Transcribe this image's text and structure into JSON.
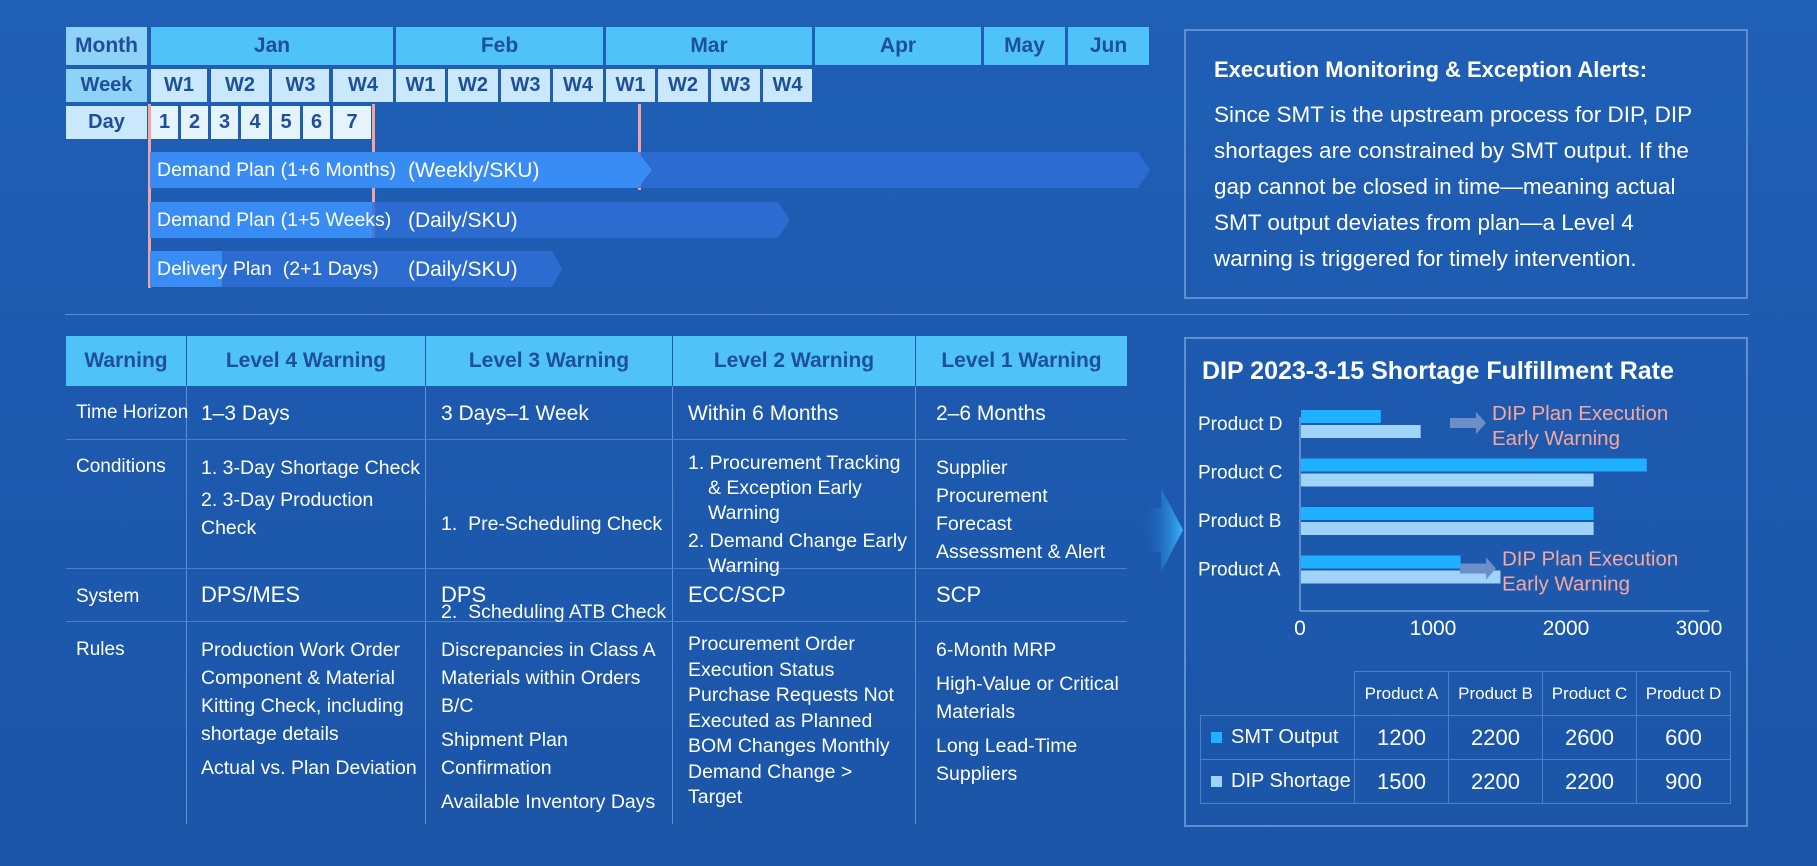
{
  "timeline": {
    "row_labels": {
      "month": "Month",
      "week": "Week",
      "day": "Day"
    },
    "months": [
      "Jan",
      "Feb",
      "Mar",
      "Apr",
      "May",
      "Jun"
    ],
    "weeks": [
      "W1",
      "W2",
      "W3",
      "W4",
      "W1",
      "W2",
      "W3",
      "W4",
      "W1",
      "W2",
      "W3",
      "W4"
    ],
    "days": [
      "1",
      "2",
      "3",
      "4",
      "5",
      "6",
      "7"
    ],
    "plans": [
      {
        "label": "Demand Plan (1+6 Months)",
        "unit": "(Weekly/SKU)"
      },
      {
        "label": "Demand Plan (1+5 Weeks)",
        "unit": "(Daily/SKU)"
      },
      {
        "label": "Delivery Plan  (2+1 Days)",
        "unit": "(Daily/SKU)"
      }
    ]
  },
  "alert_box": {
    "title": "Execution Monitoring & Exception Alerts:",
    "text": "Since SMT is the upstream process for DIP, DIP shortages are constrained by SMT output. If the gap cannot be closed in time—meaning actual SMT output deviates from plan—a Level 4 warning is triggered for timely intervention."
  },
  "warning_table": {
    "headers": [
      "Warning",
      "Level 4 Warning",
      "Level 3 Warning",
      "Level 2 Warning",
      "Level 1 Warning"
    ],
    "rows": {
      "time_horizon": {
        "label": "Time Horizon",
        "values": [
          "1–3 Days",
          "3 Days–1 Week",
          "Within 6 Months",
          "2–6 Months"
        ]
      },
      "conditions": {
        "label": "Conditions",
        "l4": [
          "1. 3-Day Shortage Check",
          "2. 3-Day Production Check"
        ],
        "l3": [
          "1.  Pre-Scheduling Check",
          "2.  Scheduling ATB Check"
        ],
        "l2": [
          "1. Procurement Tracking & Exception Early Warning",
          "2. Demand Change Early Warning"
        ],
        "l1": "Supplier Procurement Forecast Assessment & Alert"
      },
      "system": {
        "label": "System",
        "values": [
          "DPS/MES",
          "DPS",
          "ECC/SCP",
          "SCP"
        ]
      },
      "rules": {
        "label": "Rules",
        "l4": [
          "Production Work Order Component & Material Kitting Check, including shortage details",
          "Actual vs. Plan Deviation"
        ],
        "l3": [
          "Discrepancies in Class A Materials within Orders B/C",
          "Shipment Plan Confirmation",
          "Available Inventory Days"
        ],
        "l2": "Procurement Order Execution Status Purchase Requests Not Executed as Planned BOM Changes Monthly Demand Change > Target",
        "l1": [
          "6-Month MRP",
          "High-Value or Critical Materials",
          "Long Lead-Time Suppliers"
        ]
      }
    }
  },
  "colors": {
    "smt": "#1fb0ff",
    "dip": "#9fd3f7",
    "alert_text": "#f7a79e",
    "header": "#4fc3f7"
  },
  "chart_data": {
    "type": "bar",
    "orientation": "horizontal",
    "title": "DIP 2023-3-15 Shortage Fulfillment Rate",
    "categories": [
      "Product D",
      "Product C",
      "Product B",
      "Product A"
    ],
    "series": [
      {
        "name": "SMT Output",
        "values": [
          600,
          2600,
          2200,
          1200
        ]
      },
      {
        "name": "DIP Shortage",
        "values": [
          900,
          2200,
          2200,
          1500
        ]
      }
    ],
    "xlim": [
      0,
      3000
    ],
    "xticks": [
      "0",
      "1000",
      "2000",
      "3000"
    ],
    "annotations": [
      {
        "category": "Product D",
        "text_line1": "DIP Plan Execution",
        "text_line2": "Early Warning"
      },
      {
        "category": "Product A",
        "text_line1": "DIP Plan Execution",
        "text_line2": "Early Warning"
      }
    ],
    "table": {
      "columns": [
        "Product A",
        "Product B",
        "Product C",
        "Product D"
      ],
      "rows": [
        {
          "name": "SMT Output",
          "values": [
            "1200",
            "2200",
            "2600",
            "600"
          ]
        },
        {
          "name": "DIP Shortage",
          "values": [
            "1500",
            "2200",
            "2200",
            "900"
          ]
        }
      ]
    }
  }
}
